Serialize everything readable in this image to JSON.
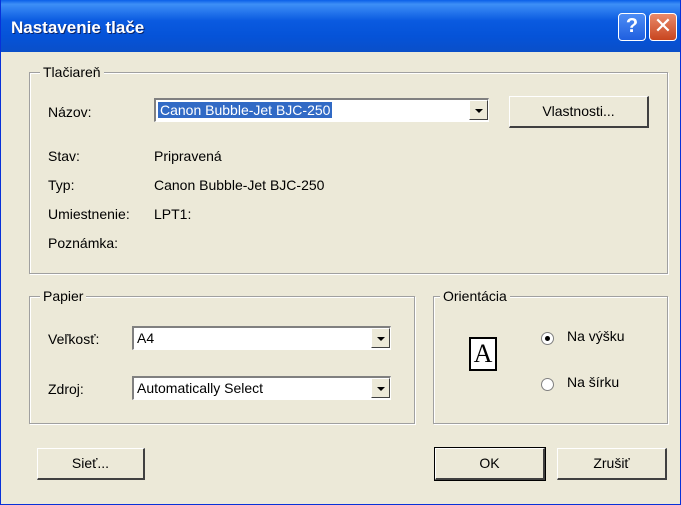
{
  "window": {
    "title": "Nastavenie tlače"
  },
  "printer": {
    "group_label": "Tlačiareň",
    "name_label": "Názov:",
    "name_value": "Canon Bubble-Jet BJC-250",
    "properties_button": "Vlastnosti...",
    "status_label": "Stav:",
    "status_value": "Pripravená",
    "type_label": "Typ:",
    "type_value": "Canon Bubble-Jet BJC-250",
    "location_label": "Umiestnenie:",
    "location_value": "LPT1:",
    "comment_label": "Poznámka:"
  },
  "paper": {
    "group_label": "Papier",
    "size_label": "Veľkosť:",
    "size_value": "A4",
    "source_label": "Zdroj:",
    "source_value": "Automatically Select"
  },
  "orientation": {
    "group_label": "Orientácia",
    "icon_letter": "A",
    "portrait_label": "Na výšku",
    "landscape_label": "Na šírku",
    "selected": "portrait"
  },
  "buttons": {
    "network": "Sieť...",
    "ok": "OK",
    "cancel": "Zrušiť"
  }
}
